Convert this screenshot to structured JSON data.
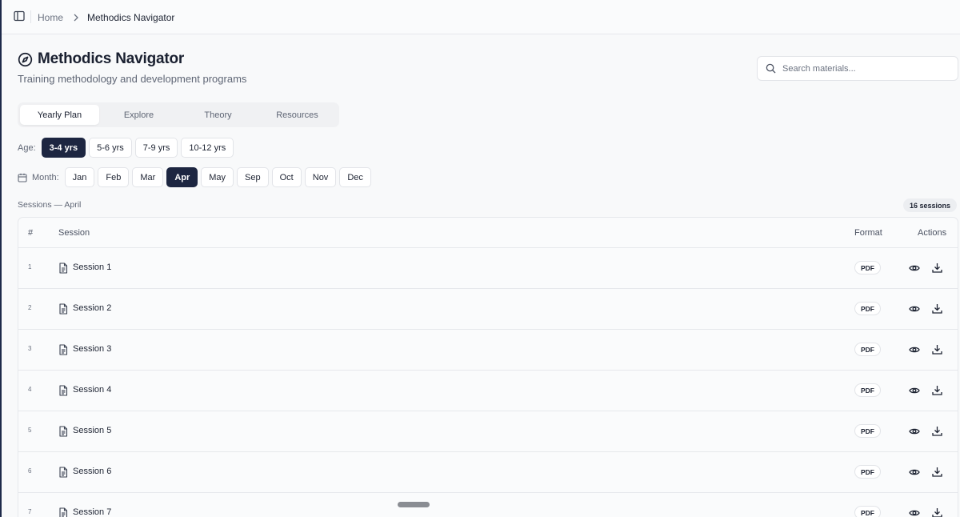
{
  "breadcrumb": {
    "home": "Home",
    "current": "Methodics Navigator"
  },
  "header": {
    "title": "Methodics Navigator",
    "subtitle": "Training methodology and development programs"
  },
  "search": {
    "placeholder": "Search materials..."
  },
  "tabs": [
    {
      "label": "Yearly Plan",
      "active": true
    },
    {
      "label": "Explore",
      "active": false
    },
    {
      "label": "Theory",
      "active": false
    },
    {
      "label": "Resources",
      "active": false
    }
  ],
  "age_filter": {
    "label": "Age:",
    "options": [
      "3-4 yrs",
      "5-6 yrs",
      "7-9 yrs",
      "10-12 yrs"
    ],
    "selected": "3-4 yrs"
  },
  "month_filter": {
    "label": "Month:",
    "options": [
      "Jan",
      "Feb",
      "Mar",
      "Apr",
      "May",
      "Sep",
      "Oct",
      "Nov",
      "Dec"
    ],
    "selected": "Apr"
  },
  "sessions": {
    "label": "Sessions — April",
    "count": "16 sessions",
    "columns": {
      "num": "#",
      "session": "Session",
      "format": "Format",
      "actions": "Actions"
    },
    "rows": [
      {
        "num": "1",
        "name": "Session 1",
        "format": "PDF"
      },
      {
        "num": "2",
        "name": "Session 2",
        "format": "PDF"
      },
      {
        "num": "3",
        "name": "Session 3",
        "format": "PDF"
      },
      {
        "num": "4",
        "name": "Session 4",
        "format": "PDF"
      },
      {
        "num": "5",
        "name": "Session 5",
        "format": "PDF"
      },
      {
        "num": "6",
        "name": "Session 6",
        "format": "PDF"
      },
      {
        "num": "7",
        "name": "Session 7",
        "format": "PDF"
      }
    ]
  },
  "icons": {
    "sidebar_toggle": "sidebar-toggle-icon",
    "breadcrumb_separator": "chevron-right-icon",
    "title": "compass-icon",
    "search": "search-icon",
    "month": "calendar-icon",
    "row_doc": "file-text-icon",
    "view": "eye-icon",
    "download": "download-icon"
  },
  "colors": {
    "accent": "#1d2641",
    "background": "#f8f9fa",
    "border": "#e6e8ec",
    "muted_text": "#5f6675"
  }
}
